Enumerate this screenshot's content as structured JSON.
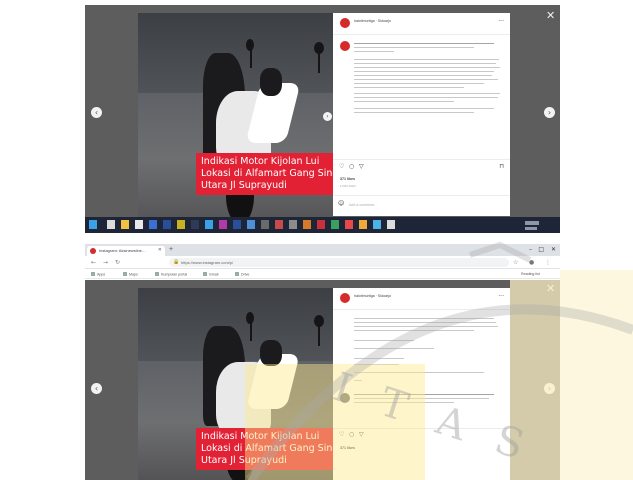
{
  "app": {
    "browser_tab_title": "Instagram: Aksinewsline…",
    "url": "https://www.instagram.com/p/",
    "bookmarks": [
      "Apps",
      "Maps",
      "Kumpulan portal",
      "Gmail",
      "Drive"
    ],
    "reading_list": "Reading list"
  },
  "post": {
    "account_handle": "halotimurtiga",
    "location": "Sidoarjo",
    "image_caption_lines": [
      "Indikasi Motor Kijolan Lui",
      "Lokasi di Alfamart Gang Singo",
      "Utara Jl Suprayudi"
    ],
    "likes_text": "371 likes",
    "timestamp": "1 DAY AGO",
    "comment_placeholder": "Add a comment..."
  },
  "watermark": "I T A S",
  "icons": {
    "close": "close-icon",
    "prev": "chevron-left-icon",
    "next": "chevron-right-icon",
    "like": "heart-icon",
    "comment": "comment-icon",
    "share": "send-icon",
    "save": "bookmark-icon",
    "emoji": "smiley-icon"
  },
  "colors": {
    "caption_bg": "#e32135",
    "viewer_bg": "#5d5d5d",
    "taskbar_bg": "#1d2536",
    "logo": "#d52b2b",
    "yellow_tint": "#fbf0c4"
  }
}
